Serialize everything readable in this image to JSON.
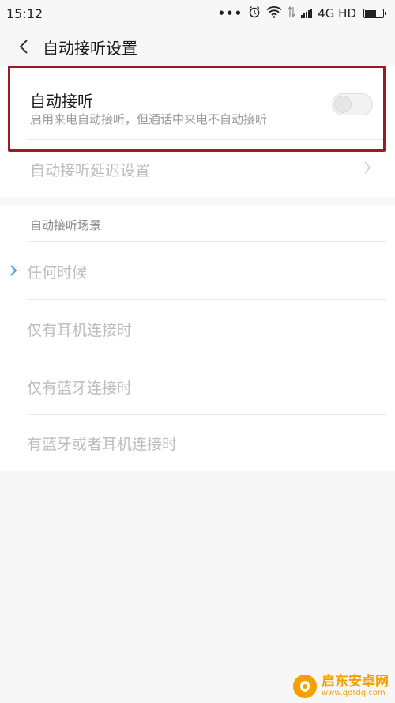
{
  "status_bar": {
    "time": "15:12",
    "dots": "•••",
    "network": "4G HD"
  },
  "header": {
    "title": "自动接听设置"
  },
  "auto_answer": {
    "title": "自动接听",
    "description": "启用来电自动接听，但通话中来电不自动接听",
    "enabled": false
  },
  "delay_setting": {
    "label": "自动接听延迟设置"
  },
  "scene": {
    "section_title": "自动接听场景",
    "options": [
      {
        "label": "任何时候",
        "selected": true
      },
      {
        "label": "仅有耳机连接时",
        "selected": false
      },
      {
        "label": "仅有蓝牙连接时",
        "selected": false
      },
      {
        "label": "有蓝牙或者耳机连接时",
        "selected": false
      }
    ]
  },
  "watermark": {
    "main": "启东安卓网",
    "sub": "www.qdtdq.com"
  },
  "colors": {
    "accent": "#3aa7e0",
    "highlight": "#9b1b25",
    "watermark": "#f5a000"
  }
}
